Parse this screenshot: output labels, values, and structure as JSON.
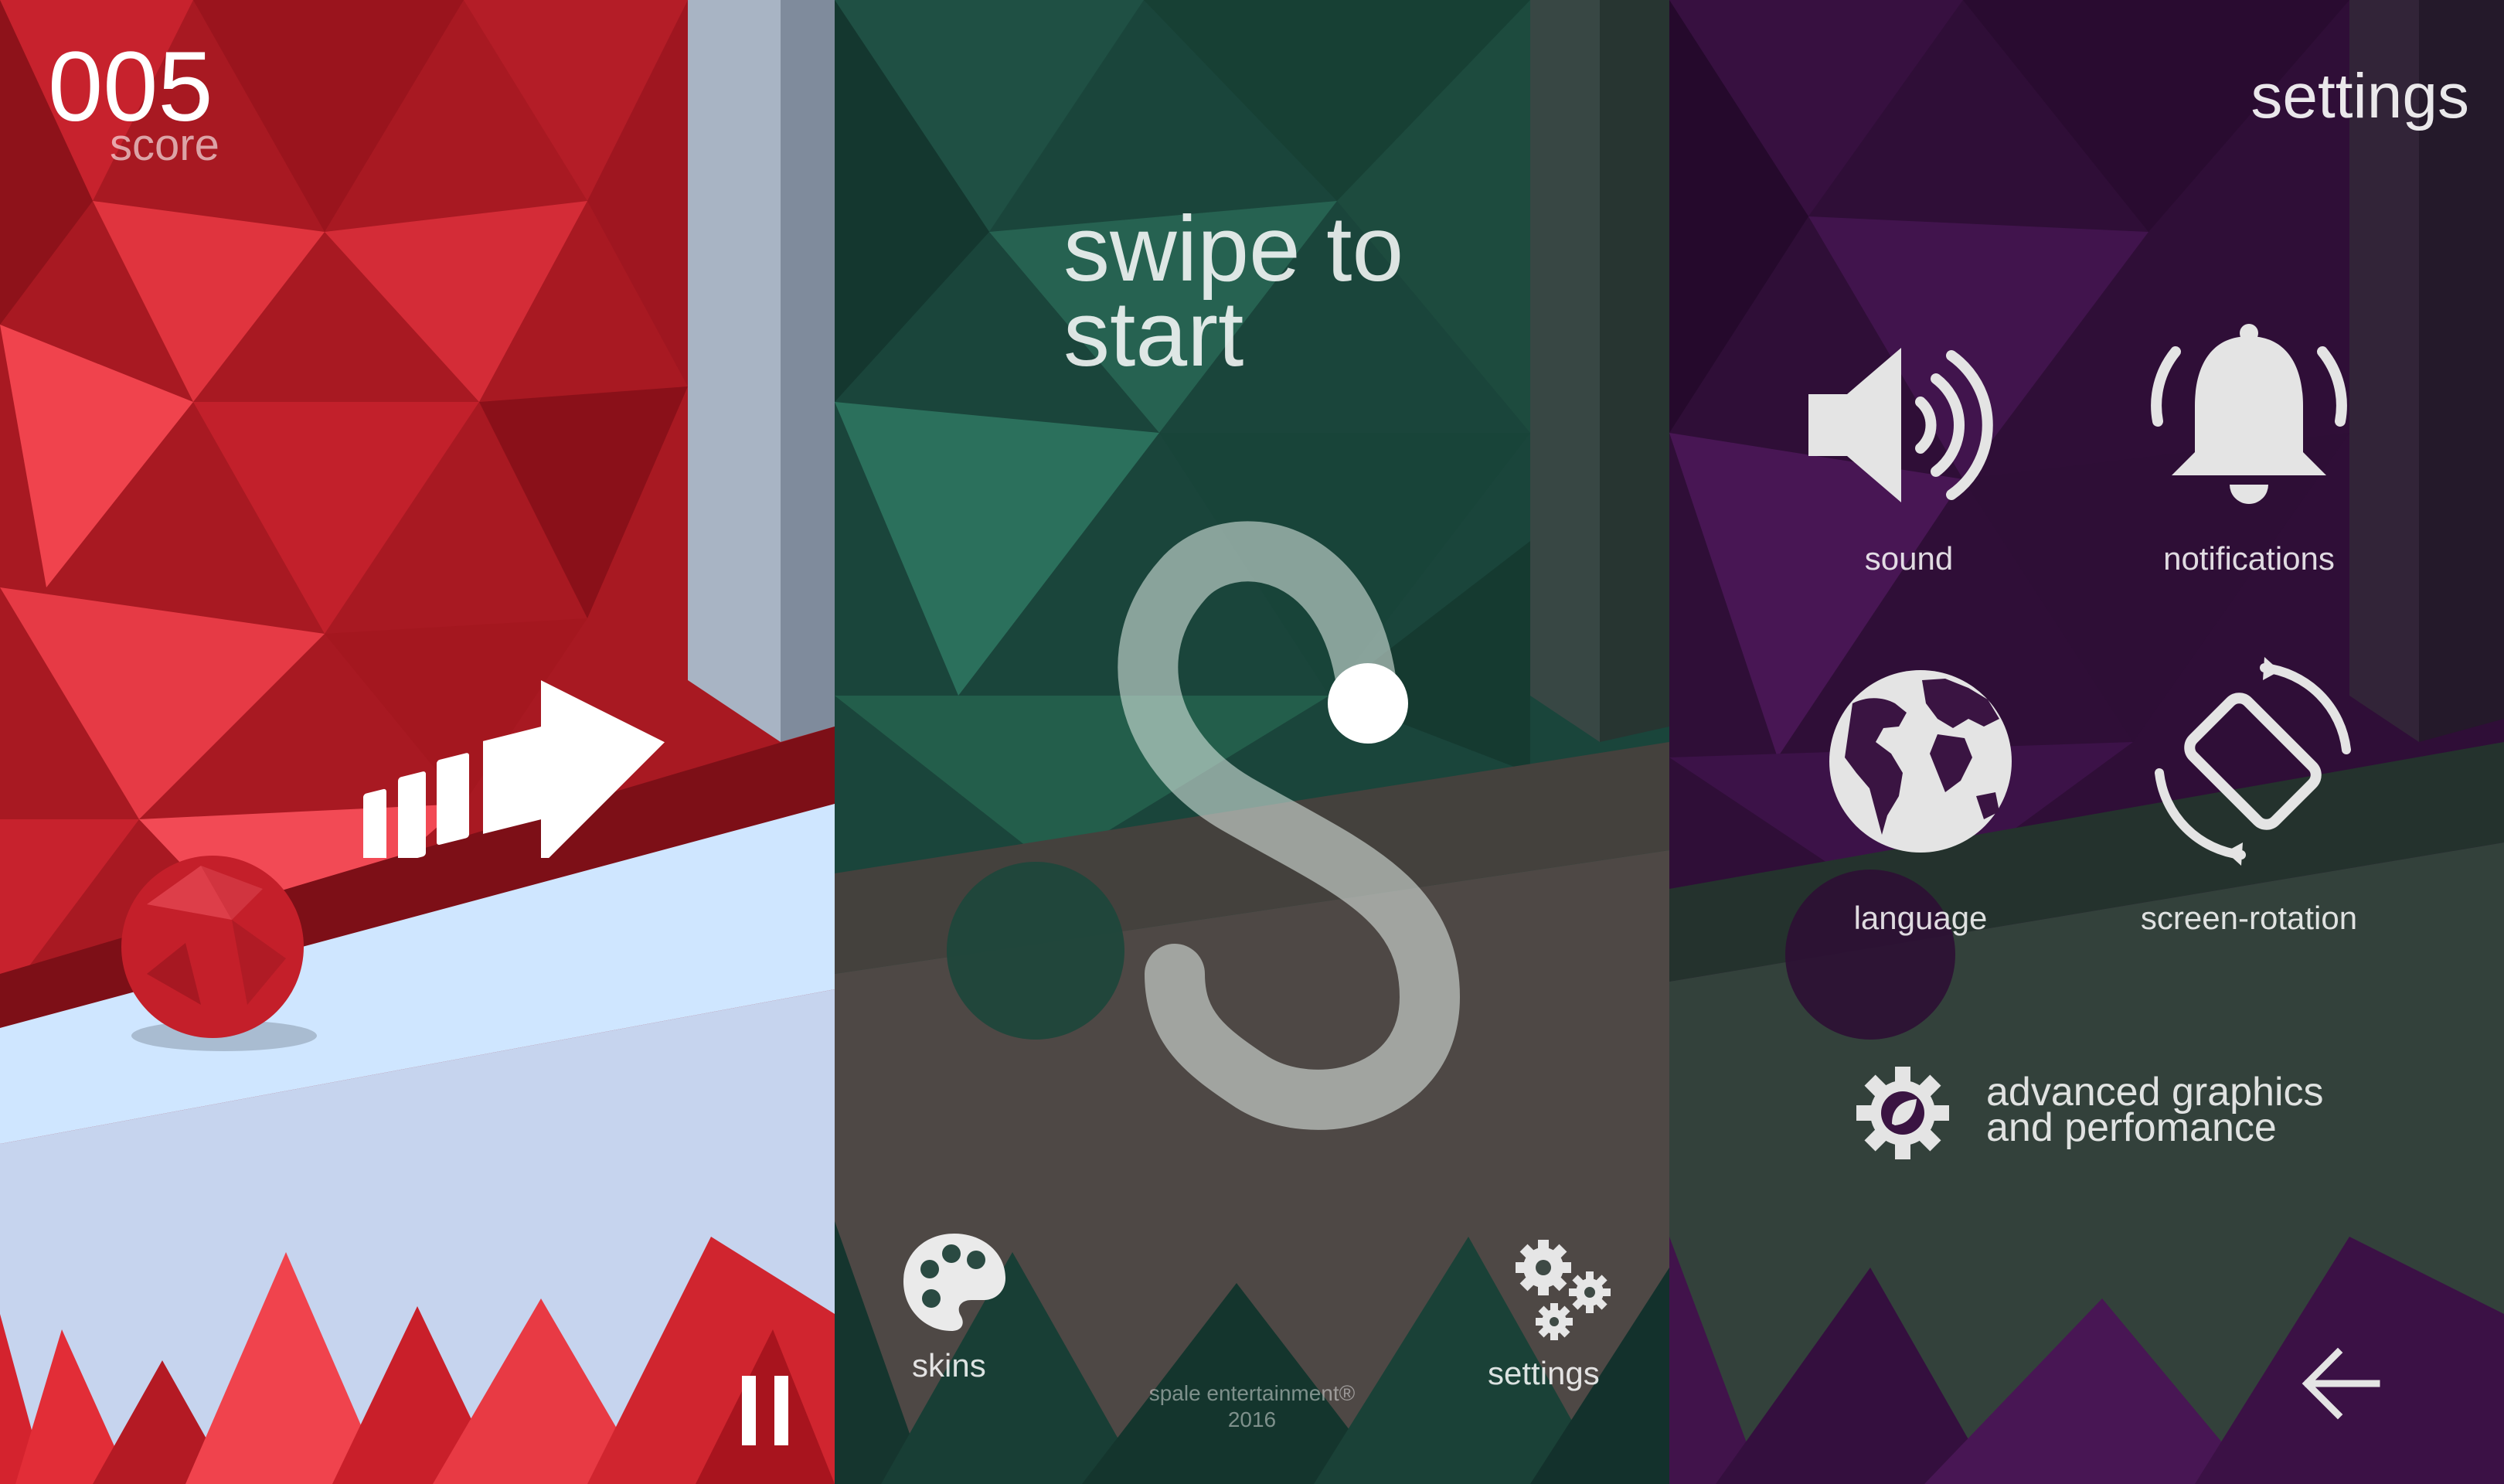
{
  "colors": {
    "red_panel": "#b81d27",
    "green_panel": "#1f5548",
    "purple_panel": "#3b1146"
  },
  "game": {
    "score_value": "005",
    "score_label": "score",
    "pause_icon": "pause-icon",
    "direction_icon": "arrow-right-icon"
  },
  "start": {
    "prompt_line1": "swipe to",
    "prompt_line2": "start",
    "gesture_icon": "s-swipe-gesture-icon",
    "skins_label": "skins",
    "skins_icon": "palette-icon",
    "settings_label": "settings",
    "settings_icon": "gears-icon",
    "credit_line1": "spale entertainment®",
    "credit_line2": "2016"
  },
  "settings": {
    "title": "settings",
    "items": [
      {
        "label": "sound",
        "icon": "speaker-icon"
      },
      {
        "label": "notifications",
        "icon": "bell-icon"
      },
      {
        "label": "language",
        "icon": "globe-icon"
      },
      {
        "label": "screen-rotation",
        "icon": "screen-rotation-icon"
      }
    ],
    "advanced_line1": "advanced graphics",
    "advanced_line2": "and perfomance",
    "advanced_icon": "gear-leaf-icon",
    "back_icon": "back-arrow-icon"
  }
}
